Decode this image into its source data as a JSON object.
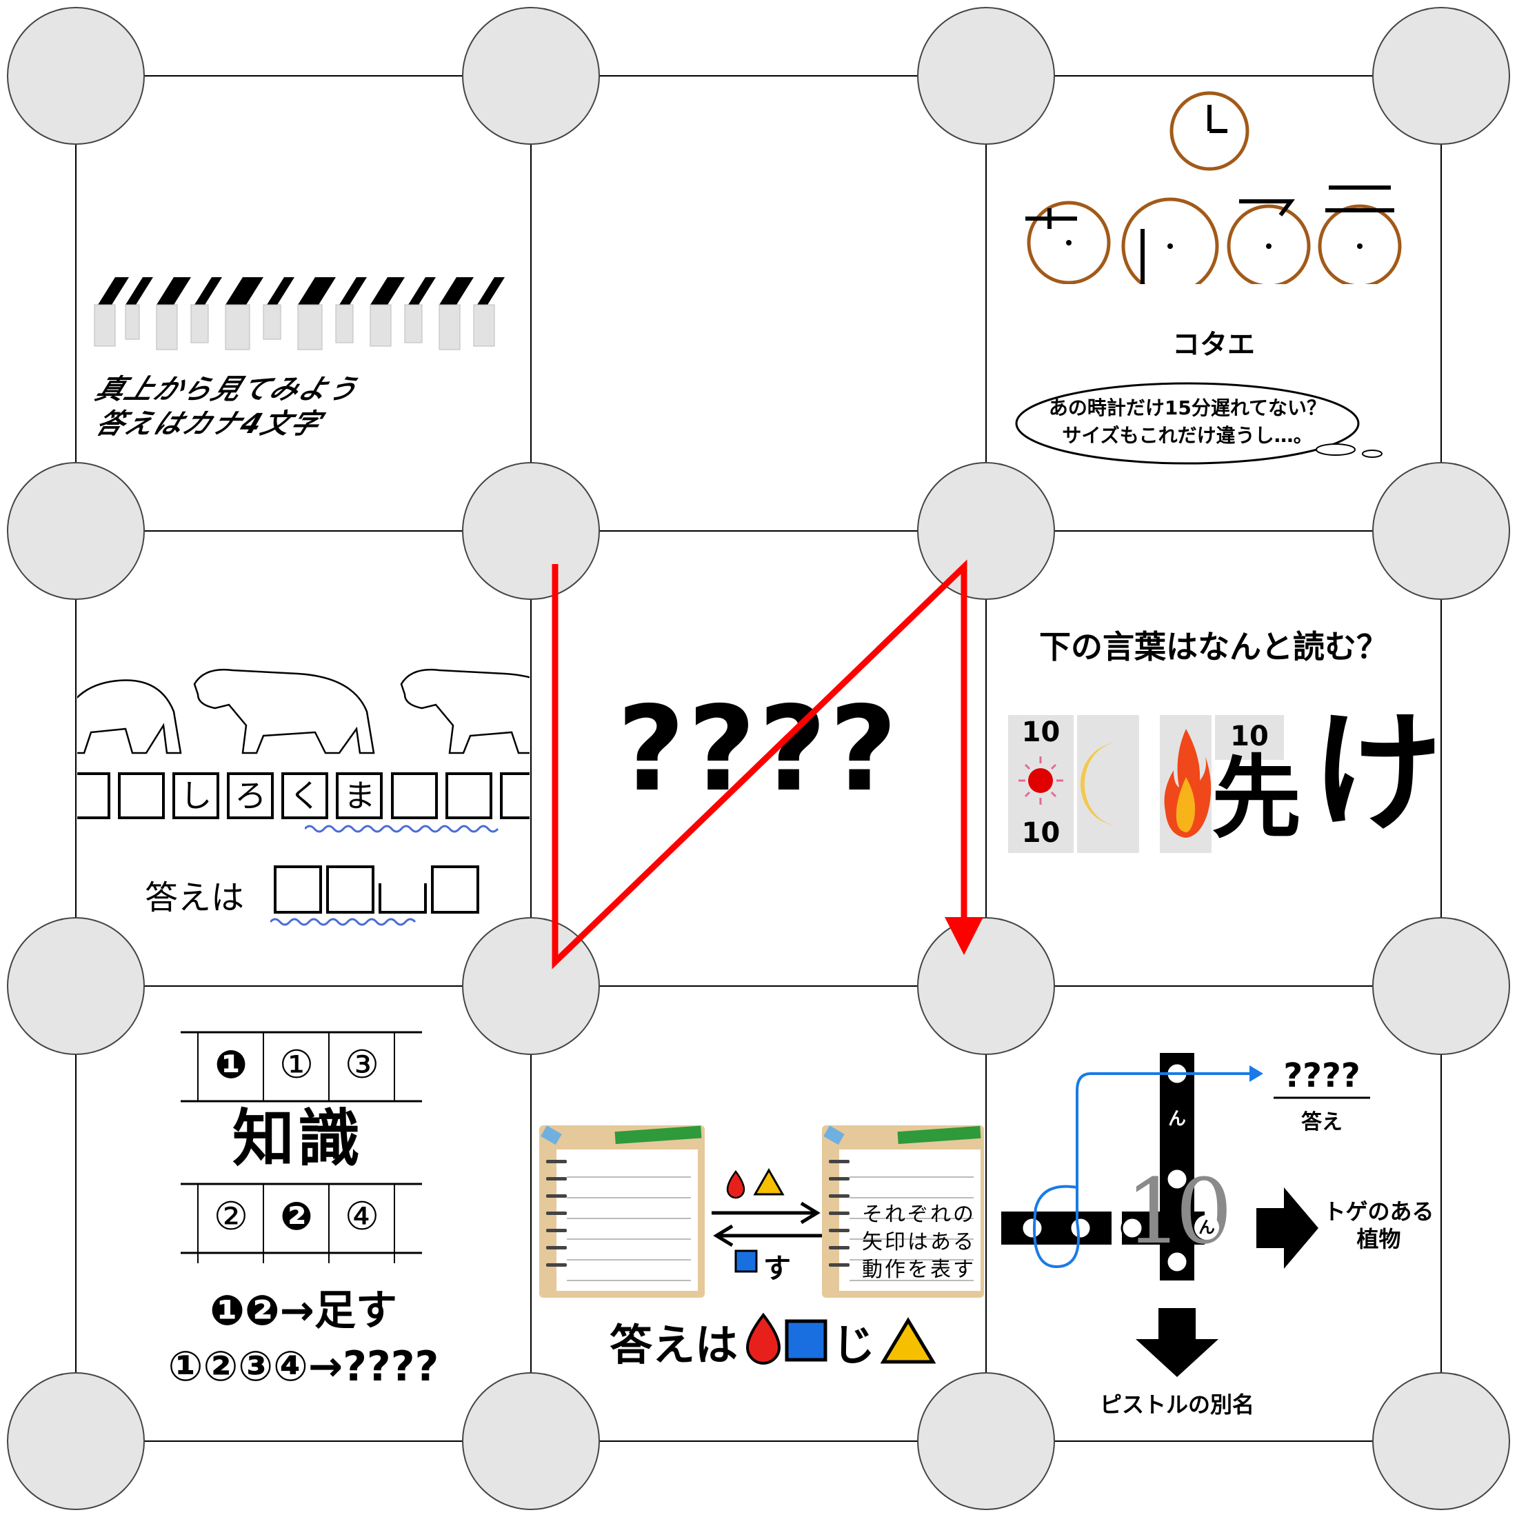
{
  "puzzle": {
    "top_left": {
      "instruction_line1": "真上から見てみよう",
      "instruction_line2": "答えはカナ4文字"
    },
    "top_right": {
      "answer_label": "コタエ",
      "thought_line1": "あの時計だけ15分遅れてない？",
      "thought_line2": "サイズもこれだけ違うし…。"
    },
    "mid_left": {
      "word_chars": [
        "し",
        "ろ",
        "く",
        "ま"
      ],
      "answer_label": "答えは"
    },
    "center": {
      "mystery": "????"
    },
    "mid_right": {
      "question": "下の言葉はなんと読む？",
      "ten_top": "10",
      "ten_bottom": "10",
      "ten_right": "10",
      "kanji_suffix": "け",
      "last_kanji": "先"
    },
    "bottom_left": {
      "row1": [
        "❶",
        "①",
        "③"
      ],
      "word": [
        "知",
        "識"
      ],
      "row3": [
        "②",
        "❷",
        "④"
      ],
      "rule1": "❶❷→足す",
      "rule2": "①②③④→????"
    },
    "bottom_mid": {
      "notebook_line1": "それぞれの",
      "notebook_line2": "矢印はある",
      "notebook_line3": "動作を表す",
      "arrow_bottom_label": "す",
      "answer_prefix": "答えは",
      "answer_ji": "じ"
    },
    "bottom_right": {
      "n_char": "ん",
      "ten_label": "10",
      "answer_mystery": "????",
      "answer_label": "答え",
      "right_label1": "トゲのある",
      "right_label2": "植物",
      "bottom_label": "ピストルの別名"
    },
    "colors": {
      "path_red": "#ff0000",
      "node_fill": "#e5e5e5",
      "drop_red": "#e8201c",
      "square_blue": "#1a6fe0",
      "triangle_yellow": "#f6c000",
      "clock_brown": "#a25a18",
      "blue_path": "#1a7ae8"
    }
  }
}
